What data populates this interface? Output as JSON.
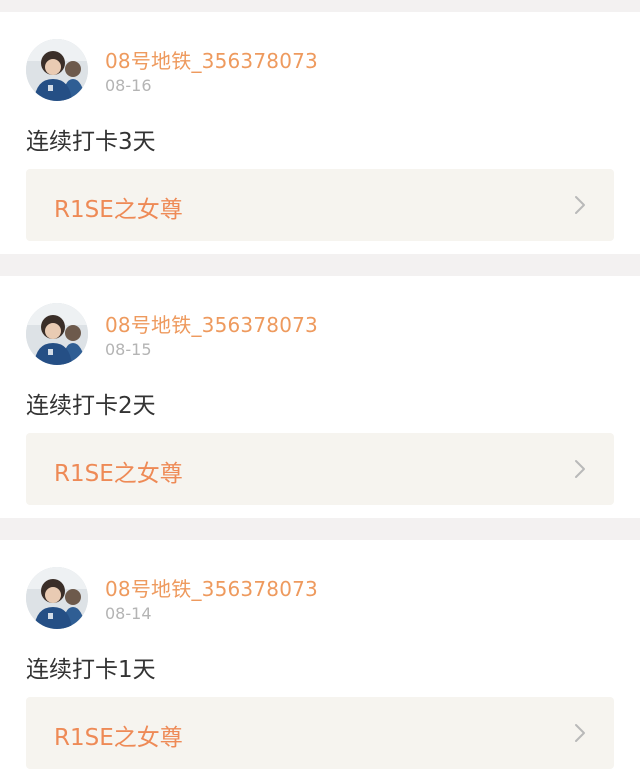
{
  "posts": [
    {
      "username": "08号地铁_356378073",
      "date": "08-16",
      "text": "连续打卡3天",
      "link_label": "R1SE之女尊"
    },
    {
      "username": "08号地铁_356378073",
      "date": "08-15",
      "text": "连续打卡2天",
      "link_label": "R1SE之女尊"
    },
    {
      "username": "08号地铁_356378073",
      "date": "08-14",
      "text": "连续打卡1天",
      "link_label": "R1SE之女尊"
    }
  ],
  "icons": {
    "chevron": "chevron-right-icon",
    "avatar": "user-avatar"
  },
  "colors": {
    "username": "#ee9a5e",
    "date": "#b4b4b4",
    "link_label": "#ee8a56",
    "link_background": "#f6f4ef",
    "page_background": "#f3f1f1"
  }
}
